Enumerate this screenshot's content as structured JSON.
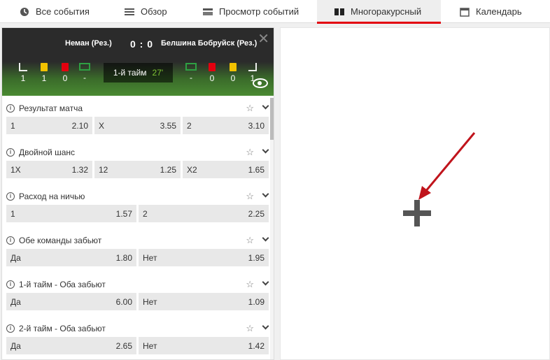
{
  "tabs": [
    {
      "label": "Все события",
      "icon": "clock-icon"
    },
    {
      "label": "Обзор",
      "icon": "list-icon"
    },
    {
      "label": "Просмотр событий",
      "icon": "monitor-icon"
    },
    {
      "label": "Многоракурсный",
      "icon": "columns-icon",
      "active": true
    },
    {
      "label": "Календарь",
      "icon": "calendar-icon"
    }
  ],
  "match": {
    "home": "Неман (Рез.)",
    "away": "Белшина Бобруйск (Рез.)",
    "score": "0 : 0",
    "period": "1-й тайм",
    "minute": "27'",
    "home_stats": [
      "1",
      "1",
      "0",
      "-"
    ],
    "away_stats": [
      "-",
      "0",
      "0",
      "1"
    ]
  },
  "markets": [
    {
      "title": "Результат матча",
      "odds": [
        [
          "1",
          "2.10"
        ],
        [
          "X",
          "3.55"
        ],
        [
          "2",
          "3.10"
        ]
      ]
    },
    {
      "title": "Двойной шанс",
      "odds": [
        [
          "1X",
          "1.32"
        ],
        [
          "12",
          "1.25"
        ],
        [
          "X2",
          "1.65"
        ]
      ]
    },
    {
      "title": "Расход на ничью",
      "odds": [
        [
          "1",
          "1.57"
        ],
        [
          "2",
          "2.25"
        ]
      ]
    },
    {
      "title": "Обе команды забьют",
      "odds": [
        [
          "Да",
          "1.80"
        ],
        [
          "Нет",
          "1.95"
        ]
      ]
    },
    {
      "title": "1-й тайм - Оба забьют",
      "odds": [
        [
          "Да",
          "6.00"
        ],
        [
          "Нет",
          "1.09"
        ]
      ]
    },
    {
      "title": "2-й тайм - Оба забьют",
      "odds": [
        [
          "Да",
          "2.65"
        ],
        [
          "Нет",
          "1.42"
        ]
      ]
    }
  ],
  "colors": {
    "accent": "#e3000f",
    "minute": "#7ec433"
  }
}
